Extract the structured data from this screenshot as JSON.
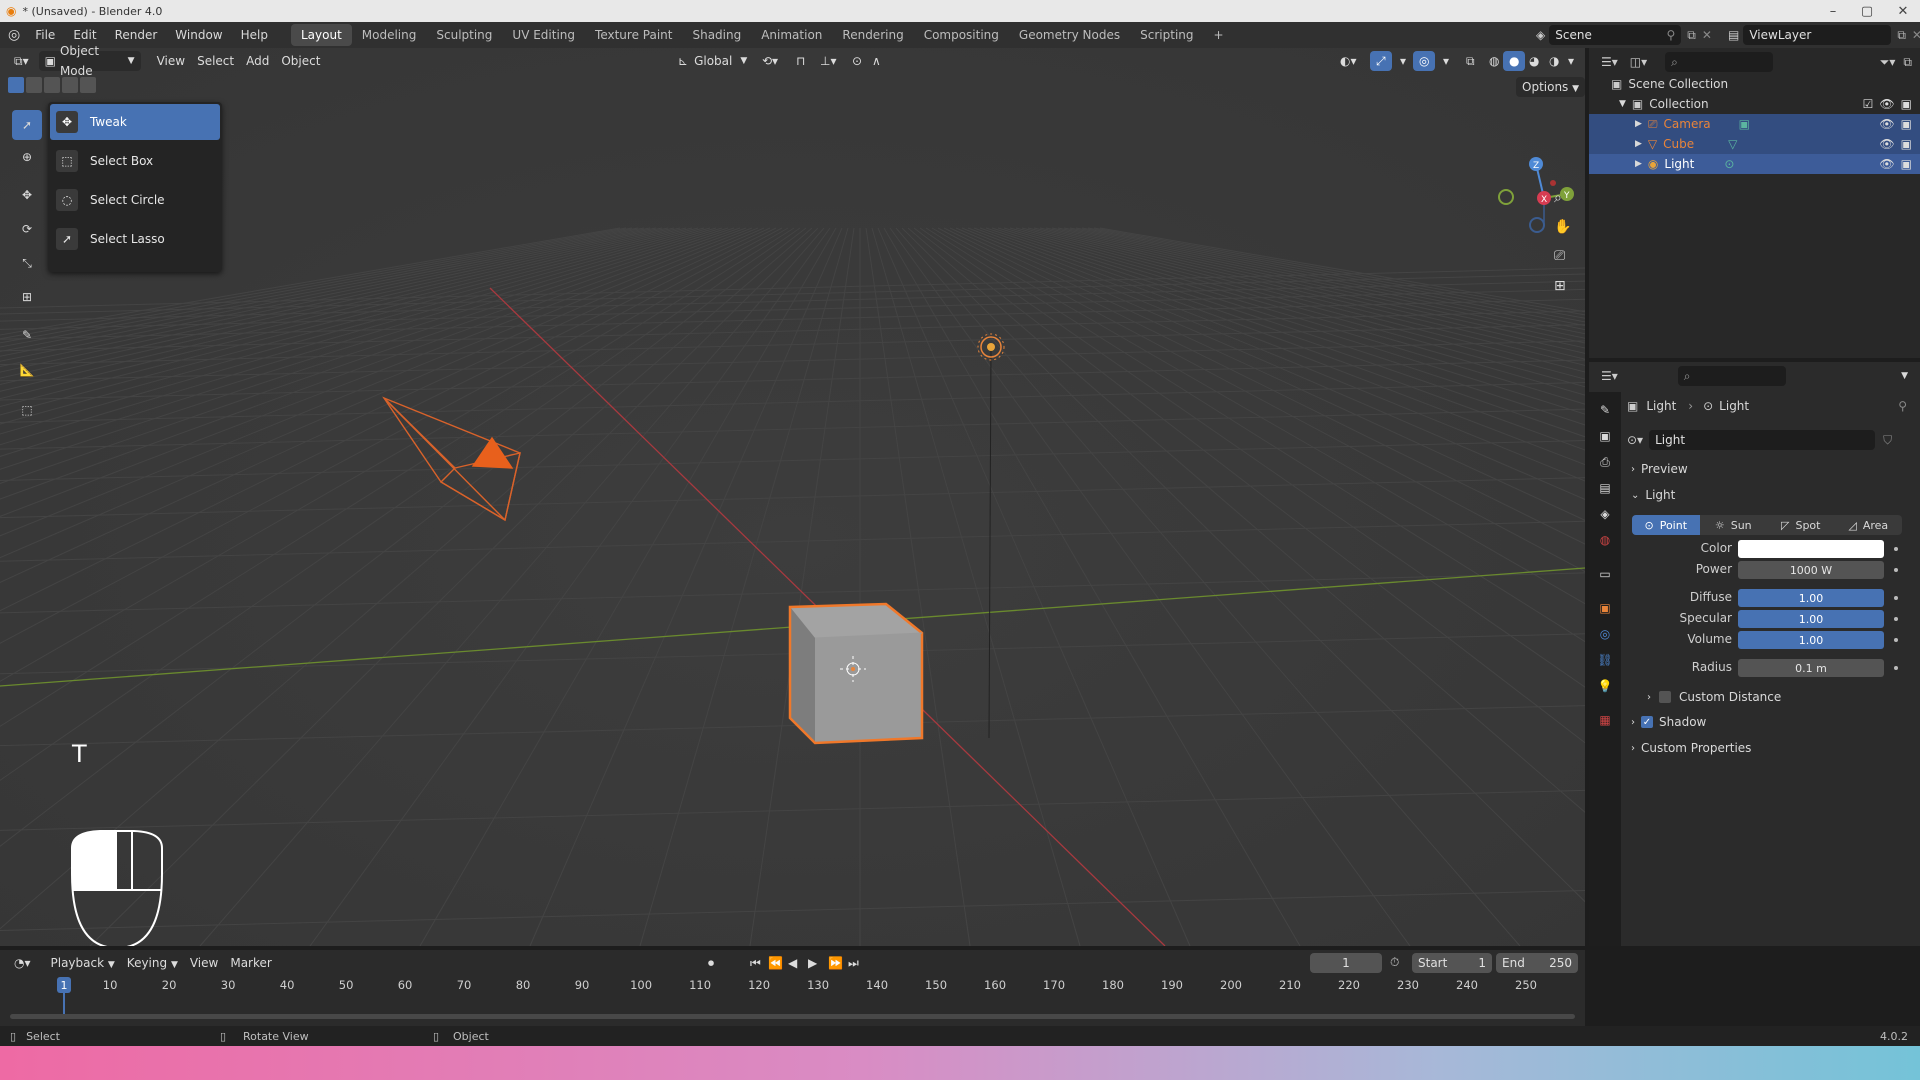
{
  "titlebar": {
    "title": "* (Unsaved) - Blender 4.0"
  },
  "menus": [
    "File",
    "Edit",
    "Render",
    "Window",
    "Help"
  ],
  "workspaces": [
    "Layout",
    "Modeling",
    "Sculpting",
    "UV Editing",
    "Texture Paint",
    "Shading",
    "Animation",
    "Rendering",
    "Compositing",
    "Geometry Nodes",
    "Scripting"
  ],
  "topbar": {
    "scene": "Scene",
    "view_layer": "ViewLayer"
  },
  "viewport": {
    "mode": "Object Mode",
    "menus": [
      "View",
      "Select",
      "Add",
      "Object"
    ],
    "orientation": "Global",
    "options": "Options",
    "keystroke": "T"
  },
  "tool_popup": {
    "items": [
      {
        "label": "Tweak",
        "active": true
      },
      {
        "label": "Select Box",
        "active": false
      },
      {
        "label": "Select Circle",
        "active": false
      },
      {
        "label": "Select Lasso",
        "active": false
      }
    ]
  },
  "outliner": {
    "scene_collection": "Scene Collection",
    "collection": "Collection",
    "items": [
      {
        "name": "Camera",
        "color": "#e8843a"
      },
      {
        "name": "Cube",
        "color": "#e8843a"
      },
      {
        "name": "Light",
        "color": "#e0e0e0"
      }
    ]
  },
  "properties": {
    "breadcrumb_object": "Light",
    "breadcrumb_data": "Light",
    "datablock": "Light",
    "sections": {
      "preview": "Preview",
      "light": "Light",
      "custom_distance": "Custom Distance",
      "shadow": "Shadow",
      "custom_properties": "Custom Properties"
    },
    "light_types": [
      "Point",
      "Sun",
      "Spot",
      "Area"
    ],
    "active_light_type": "Point",
    "fields": {
      "color_label": "Color",
      "power_label": "Power",
      "power_value": "1000 W",
      "diffuse_label": "Diffuse",
      "diffuse_value": "1.00",
      "specular_label": "Specular",
      "specular_value": "1.00",
      "volume_label": "Volume",
      "volume_value": "1.00",
      "radius_label": "Radius",
      "radius_value": "0.1 m"
    },
    "shadow_checked": true
  },
  "timeline": {
    "menus": [
      "Playback",
      "Keying",
      "View",
      "Marker"
    ],
    "current_frame": "1",
    "start_label": "Start",
    "start": "1",
    "end_label": "End",
    "end": "250",
    "ticks": [
      "1",
      "10",
      "20",
      "30",
      "40",
      "50",
      "60",
      "70",
      "80",
      "90",
      "100",
      "110",
      "120",
      "130",
      "140",
      "150",
      "160",
      "170",
      "180",
      "190",
      "200",
      "210",
      "220",
      "230",
      "240",
      "250"
    ]
  },
  "statusbar": {
    "select": "Select",
    "rotate": "Rotate View",
    "object": "Object",
    "version": "4.0.2"
  },
  "colors": {
    "accent": "#4772b3",
    "selection_orange": "#e8843a",
    "viewport_bg": "#393939"
  }
}
